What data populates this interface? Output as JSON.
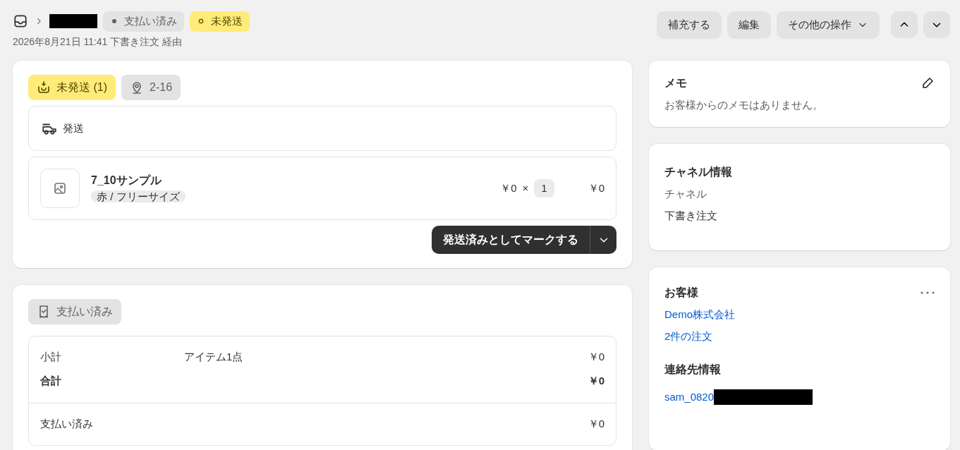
{
  "header": {
    "status_badges": [
      {
        "label": "支払い済み",
        "kind": "complete"
      },
      {
        "label": "未発送",
        "kind": "incomplete"
      }
    ],
    "subtitle": "2026年8月21日 11:41 下書き注文 経由",
    "actions": [
      {
        "label": "補充する",
        "caret": false
      },
      {
        "label": "編集",
        "caret": false
      },
      {
        "label": "その他の操作",
        "caret": true
      }
    ]
  },
  "fulfillment": {
    "status_badge": "未発送 (1)",
    "location_badge": "2-16",
    "delivery_label": "発送",
    "line_item": {
      "title": "7_10サンプル",
      "variant": "赤 / フリーサイズ",
      "price": "￥0",
      "times": "×",
      "quantity": "1",
      "total": "￥0"
    },
    "primary_button": "発送済みとしてマークする"
  },
  "payment": {
    "badge": "支払い済み",
    "rows": [
      {
        "label": "小計",
        "description": "アイテム1点",
        "amount": "￥0",
        "bold": false
      },
      {
        "label": "合計",
        "amount": "￥0",
        "bold": true
      }
    ],
    "paid_row": {
      "label": "支払い済み",
      "amount": "￥0"
    }
  },
  "note": {
    "title": "メモ",
    "text": "お客様からのメモはありません。"
  },
  "channel": {
    "title": "チャネル情報",
    "label": "チャネル",
    "value": "下書き注文"
  },
  "customer": {
    "title": "お客様",
    "name": "Demo株式会社",
    "orders": "2件の注文",
    "contact_title": "連絡先情報",
    "email": "sam_0820"
  }
}
